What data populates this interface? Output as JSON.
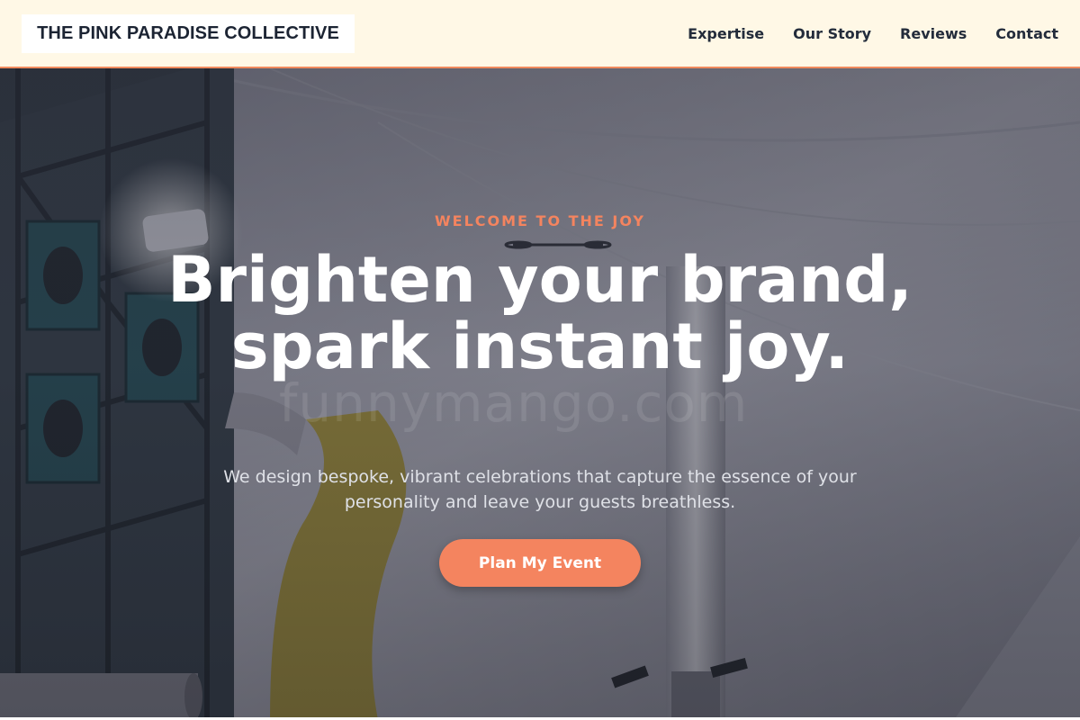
{
  "header": {
    "brand": "THE PINK PARADISE COLLECTIVE",
    "nav": [
      {
        "label": "Expertise"
      },
      {
        "label": "Our Story"
      },
      {
        "label": "Reviews"
      },
      {
        "label": "Contact"
      }
    ]
  },
  "hero": {
    "eyebrow": "WELCOME TO THE JOY",
    "headline": "Brighten your brand, spark instant joy.",
    "subtext": "We design bespoke, vibrant celebrations that capture the essence of your personality and leave your guests breathless.",
    "cta_label": "Plan My Event",
    "watermark": "funnymango.com",
    "background_image": "stage-lighting-truss-and-slide-under-tent"
  },
  "colors": {
    "accent": "#f4845f",
    "header_bg": "#fff8e6",
    "header_border": "#f08a5d",
    "text_dark": "#1c2433"
  }
}
